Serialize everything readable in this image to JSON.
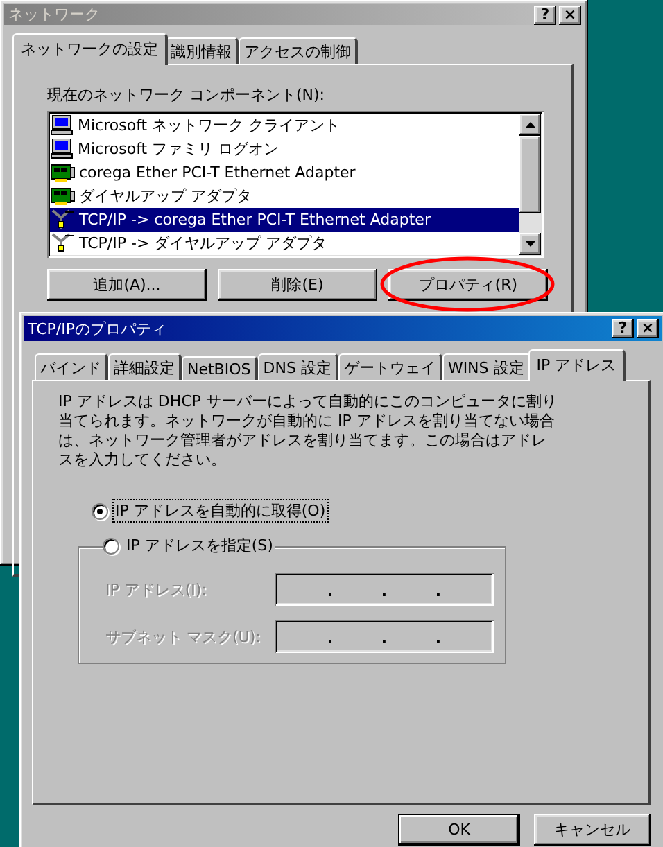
{
  "back_window": {
    "title": "ネットワーク",
    "active": false,
    "title_buttons": [
      "?",
      "×"
    ],
    "tabs": [
      {
        "label": "ネットワークの設定",
        "selected": true
      },
      {
        "label": "識別情報",
        "selected": false
      },
      {
        "label": "アクセスの制御",
        "selected": false
      }
    ],
    "components_label": "現在のネットワーク コンポーネント(N):",
    "components": [
      {
        "label": "Microsoft ネットワーク クライアント",
        "kind": "client",
        "selected": false
      },
      {
        "label": "Microsoft ファミリ ログオン",
        "kind": "client",
        "selected": false
      },
      {
        "label": "corega Ether PCI-T Ethernet Adapter",
        "kind": "adapter",
        "selected": false
      },
      {
        "label": "ダイヤルアップ アダプタ",
        "kind": "adapter",
        "selected": false
      },
      {
        "label": "TCP/IP -> corega Ether PCI-T Ethernet Adapter",
        "kind": "protocol",
        "selected": true
      },
      {
        "label": "TCP/IP -> ダイヤルアップ アダプタ",
        "kind": "protocol",
        "selected": false
      }
    ],
    "buttons": [
      {
        "label": "追加(A)...",
        "highlighted": false
      },
      {
        "label": "削除(E)",
        "highlighted": false
      },
      {
        "label": "プロパティ(R)",
        "highlighted": true
      }
    ]
  },
  "front_window": {
    "title": "TCP/IPのプロパティ",
    "active": true,
    "title_buttons": [
      "?",
      "×"
    ],
    "tabs": [
      {
        "label": "バインド",
        "selected": false
      },
      {
        "label": "詳細設定",
        "selected": false
      },
      {
        "label": "NetBIOS",
        "selected": false
      },
      {
        "label": "DNS 設定",
        "selected": false
      },
      {
        "label": "ゲートウェイ",
        "selected": false
      },
      {
        "label": "WINS 設定",
        "selected": false
      },
      {
        "label": "IP アドレス",
        "selected": true
      }
    ],
    "description": "IP アドレスは DHCP サーバーによって自動的にこのコンピュータに割り当てられます。ネットワークが自動的に IP アドレスを割り当てない場合は、ネットワーク管理者がアドレスを割り当てます。この場合はアドレスを入力してください。",
    "options": [
      {
        "label": "IP アドレスを自動的に取得(O)",
        "selected": true,
        "focused": true
      },
      {
        "label": "IP アドレスを指定(S)",
        "selected": false,
        "focused": false
      }
    ],
    "fields": [
      {
        "label": "IP アドレス(I):",
        "disabled": true,
        "separators": [
          ".",
          ".",
          "."
        ]
      },
      {
        "label": "サブネット マスク(U):",
        "disabled": true,
        "separators": [
          ".",
          ".",
          "."
        ]
      }
    ],
    "buttons": [
      {
        "label": "OK",
        "default": true
      },
      {
        "label": "キャンセル",
        "default": false
      }
    ]
  }
}
